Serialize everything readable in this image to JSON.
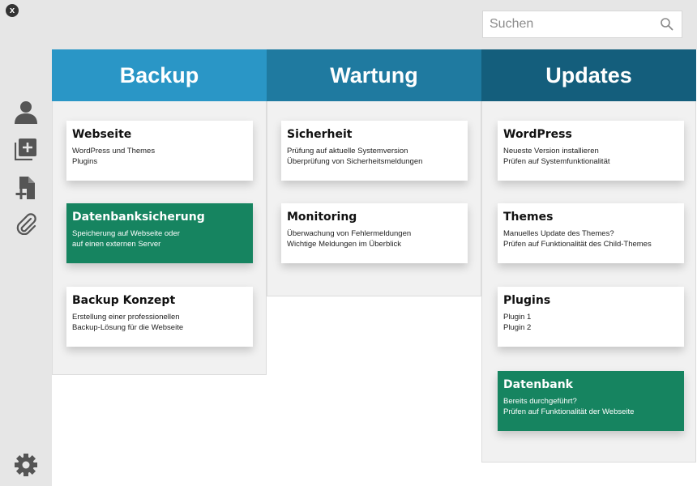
{
  "window": {
    "close_label": "x"
  },
  "search": {
    "placeholder": "Suchen",
    "value": ""
  },
  "sidebar": {
    "icons": [
      "user-icon",
      "add-list-icon",
      "add-file-icon",
      "paperclip-icon"
    ],
    "bottom_icon": "gear-icon"
  },
  "colors": {
    "chrome": "#e6e6e6",
    "backup": "#2a96c6",
    "wartung": "#1f7aa0",
    "updates": "#145e7c",
    "green_card": "#168460"
  },
  "columns": [
    {
      "title": "Backup",
      "cards": [
        {
          "title": "Webseite",
          "lines": [
            "WordPress und Themes",
            "Plugins"
          ],
          "highlight": false
        },
        {
          "title": "Datenbanksicherung",
          "lines": [
            "Speicherung auf Webseite oder",
            "auf einen externen Server"
          ],
          "highlight": true
        },
        {
          "title": "Backup Konzept",
          "lines": [
            "Erstellung einer professionellen",
            "Backup-Lösung für die Webseite"
          ],
          "highlight": false
        }
      ]
    },
    {
      "title": "Wartung",
      "cards": [
        {
          "title": "Sicherheit",
          "lines": [
            "Prüfung auf aktuelle Systemversion",
            "Überprüfung von Sicherheitsmeldungen"
          ],
          "highlight": false
        },
        {
          "title": "Monitoring",
          "lines": [
            "Überwachung von Fehlermeldungen",
            "Wichtige Meldungen im Überblick"
          ],
          "highlight": false
        }
      ]
    },
    {
      "title": "Updates",
      "cards": [
        {
          "title": "WordPress",
          "lines": [
            "Neueste Version installieren",
            "Prüfen auf Systemfunktionalität"
          ],
          "highlight": false
        },
        {
          "title": "Themes",
          "lines": [
            "Manuelles Update des Themes?",
            "Prüfen auf Funktionalität des Child-Themes"
          ],
          "highlight": false
        },
        {
          "title": "Plugins",
          "lines": [
            "Plugin 1",
            "Plugin 2"
          ],
          "highlight": false
        },
        {
          "title": "Datenbank",
          "lines": [
            "Bereits durchgeführt?",
            "Prüfen auf Funktionalität der Webseite"
          ],
          "highlight": true
        }
      ]
    }
  ]
}
